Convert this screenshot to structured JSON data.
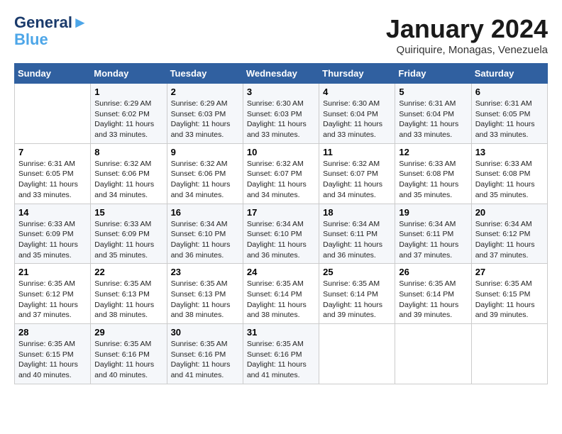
{
  "header": {
    "logo_line1": "General",
    "logo_line2": "Blue",
    "month_title": "January 2024",
    "subtitle": "Quiriquire, Monagas, Venezuela"
  },
  "days_of_week": [
    "Sunday",
    "Monday",
    "Tuesday",
    "Wednesday",
    "Thursday",
    "Friday",
    "Saturday"
  ],
  "weeks": [
    [
      {
        "day": "",
        "sunrise": "",
        "sunset": "",
        "daylight": ""
      },
      {
        "day": "1",
        "sunrise": "Sunrise: 6:29 AM",
        "sunset": "Sunset: 6:02 PM",
        "daylight": "Daylight: 11 hours and 33 minutes."
      },
      {
        "day": "2",
        "sunrise": "Sunrise: 6:29 AM",
        "sunset": "Sunset: 6:03 PM",
        "daylight": "Daylight: 11 hours and 33 minutes."
      },
      {
        "day": "3",
        "sunrise": "Sunrise: 6:30 AM",
        "sunset": "Sunset: 6:03 PM",
        "daylight": "Daylight: 11 hours and 33 minutes."
      },
      {
        "day": "4",
        "sunrise": "Sunrise: 6:30 AM",
        "sunset": "Sunset: 6:04 PM",
        "daylight": "Daylight: 11 hours and 33 minutes."
      },
      {
        "day": "5",
        "sunrise": "Sunrise: 6:31 AM",
        "sunset": "Sunset: 6:04 PM",
        "daylight": "Daylight: 11 hours and 33 minutes."
      },
      {
        "day": "6",
        "sunrise": "Sunrise: 6:31 AM",
        "sunset": "Sunset: 6:05 PM",
        "daylight": "Daylight: 11 hours and 33 minutes."
      }
    ],
    [
      {
        "day": "7",
        "sunrise": "Sunrise: 6:31 AM",
        "sunset": "Sunset: 6:05 PM",
        "daylight": "Daylight: 11 hours and 33 minutes."
      },
      {
        "day": "8",
        "sunrise": "Sunrise: 6:32 AM",
        "sunset": "Sunset: 6:06 PM",
        "daylight": "Daylight: 11 hours and 34 minutes."
      },
      {
        "day": "9",
        "sunrise": "Sunrise: 6:32 AM",
        "sunset": "Sunset: 6:06 PM",
        "daylight": "Daylight: 11 hours and 34 minutes."
      },
      {
        "day": "10",
        "sunrise": "Sunrise: 6:32 AM",
        "sunset": "Sunset: 6:07 PM",
        "daylight": "Daylight: 11 hours and 34 minutes."
      },
      {
        "day": "11",
        "sunrise": "Sunrise: 6:32 AM",
        "sunset": "Sunset: 6:07 PM",
        "daylight": "Daylight: 11 hours and 34 minutes."
      },
      {
        "day": "12",
        "sunrise": "Sunrise: 6:33 AM",
        "sunset": "Sunset: 6:08 PM",
        "daylight": "Daylight: 11 hours and 35 minutes."
      },
      {
        "day": "13",
        "sunrise": "Sunrise: 6:33 AM",
        "sunset": "Sunset: 6:08 PM",
        "daylight": "Daylight: 11 hours and 35 minutes."
      }
    ],
    [
      {
        "day": "14",
        "sunrise": "Sunrise: 6:33 AM",
        "sunset": "Sunset: 6:09 PM",
        "daylight": "Daylight: 11 hours and 35 minutes."
      },
      {
        "day": "15",
        "sunrise": "Sunrise: 6:33 AM",
        "sunset": "Sunset: 6:09 PM",
        "daylight": "Daylight: 11 hours and 35 minutes."
      },
      {
        "day": "16",
        "sunrise": "Sunrise: 6:34 AM",
        "sunset": "Sunset: 6:10 PM",
        "daylight": "Daylight: 11 hours and 36 minutes."
      },
      {
        "day": "17",
        "sunrise": "Sunrise: 6:34 AM",
        "sunset": "Sunset: 6:10 PM",
        "daylight": "Daylight: 11 hours and 36 minutes."
      },
      {
        "day": "18",
        "sunrise": "Sunrise: 6:34 AM",
        "sunset": "Sunset: 6:11 PM",
        "daylight": "Daylight: 11 hours and 36 minutes."
      },
      {
        "day": "19",
        "sunrise": "Sunrise: 6:34 AM",
        "sunset": "Sunset: 6:11 PM",
        "daylight": "Daylight: 11 hours and 37 minutes."
      },
      {
        "day": "20",
        "sunrise": "Sunrise: 6:34 AM",
        "sunset": "Sunset: 6:12 PM",
        "daylight": "Daylight: 11 hours and 37 minutes."
      }
    ],
    [
      {
        "day": "21",
        "sunrise": "Sunrise: 6:35 AM",
        "sunset": "Sunset: 6:12 PM",
        "daylight": "Daylight: 11 hours and 37 minutes."
      },
      {
        "day": "22",
        "sunrise": "Sunrise: 6:35 AM",
        "sunset": "Sunset: 6:13 PM",
        "daylight": "Daylight: 11 hours and 38 minutes."
      },
      {
        "day": "23",
        "sunrise": "Sunrise: 6:35 AM",
        "sunset": "Sunset: 6:13 PM",
        "daylight": "Daylight: 11 hours and 38 minutes."
      },
      {
        "day": "24",
        "sunrise": "Sunrise: 6:35 AM",
        "sunset": "Sunset: 6:14 PM",
        "daylight": "Daylight: 11 hours and 38 minutes."
      },
      {
        "day": "25",
        "sunrise": "Sunrise: 6:35 AM",
        "sunset": "Sunset: 6:14 PM",
        "daylight": "Daylight: 11 hours and 39 minutes."
      },
      {
        "day": "26",
        "sunrise": "Sunrise: 6:35 AM",
        "sunset": "Sunset: 6:14 PM",
        "daylight": "Daylight: 11 hours and 39 minutes."
      },
      {
        "day": "27",
        "sunrise": "Sunrise: 6:35 AM",
        "sunset": "Sunset: 6:15 PM",
        "daylight": "Daylight: 11 hours and 39 minutes."
      }
    ],
    [
      {
        "day": "28",
        "sunrise": "Sunrise: 6:35 AM",
        "sunset": "Sunset: 6:15 PM",
        "daylight": "Daylight: 11 hours and 40 minutes."
      },
      {
        "day": "29",
        "sunrise": "Sunrise: 6:35 AM",
        "sunset": "Sunset: 6:16 PM",
        "daylight": "Daylight: 11 hours and 40 minutes."
      },
      {
        "day": "30",
        "sunrise": "Sunrise: 6:35 AM",
        "sunset": "Sunset: 6:16 PM",
        "daylight": "Daylight: 11 hours and 41 minutes."
      },
      {
        "day": "31",
        "sunrise": "Sunrise: 6:35 AM",
        "sunset": "Sunset: 6:16 PM",
        "daylight": "Daylight: 11 hours and 41 minutes."
      },
      {
        "day": "",
        "sunrise": "",
        "sunset": "",
        "daylight": ""
      },
      {
        "day": "",
        "sunrise": "",
        "sunset": "",
        "daylight": ""
      },
      {
        "day": "",
        "sunrise": "",
        "sunset": "",
        "daylight": ""
      }
    ]
  ]
}
